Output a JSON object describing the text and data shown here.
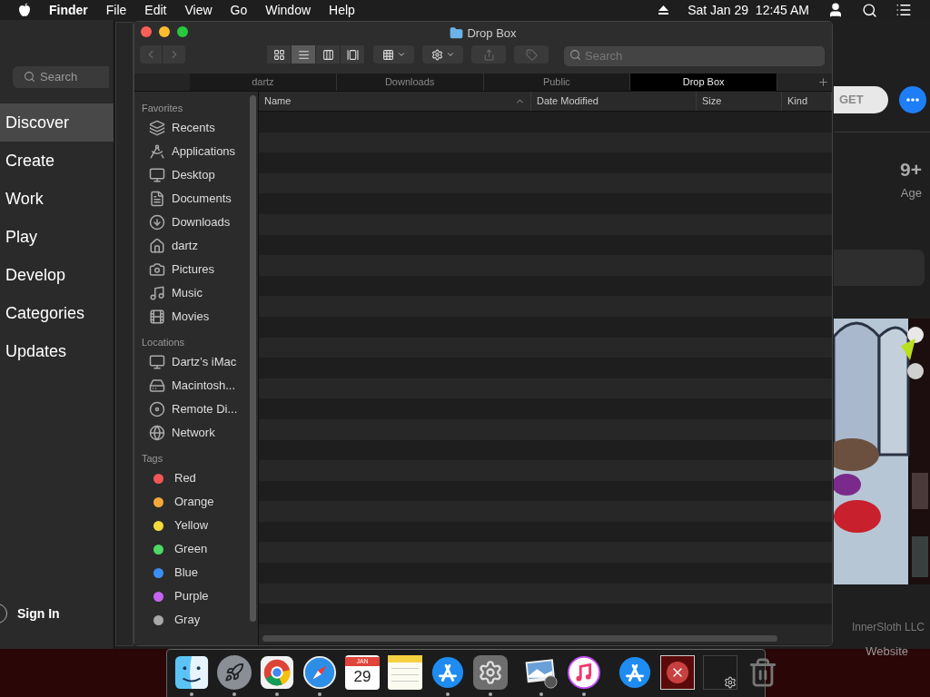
{
  "menu_bar": {
    "app": "Finder",
    "menus": [
      "File",
      "Edit",
      "View",
      "Go",
      "Window",
      "Help"
    ],
    "clock": "Sat Jan 29  12:45 AM"
  },
  "app_store": {
    "search": {
      "placeholder": "Search"
    },
    "nav": [
      {
        "label": "Discover",
        "selected": true
      },
      {
        "label": "Create",
        "selected": false
      },
      {
        "label": "Work",
        "selected": false
      },
      {
        "label": "Play",
        "selected": false
      },
      {
        "label": "Develop",
        "selected": false
      },
      {
        "label": "Categories",
        "selected": false
      },
      {
        "label": "Updates",
        "selected": false
      }
    ],
    "sign_in": "Sign In",
    "get_button": "GET",
    "age": {
      "value": "9+",
      "label": "Age"
    },
    "developer": "InnerSloth LLC",
    "link": "Website"
  },
  "finder": {
    "title": "Drop Box",
    "view_modes": [
      {
        "kind": "icon",
        "selected": false
      },
      {
        "kind": "list",
        "selected": true
      },
      {
        "kind": "column",
        "selected": false
      },
      {
        "kind": "gallery",
        "selected": false
      }
    ],
    "share_disabled": true,
    "tags_disabled": true,
    "search": {
      "placeholder": "Search"
    },
    "tabs": [
      {
        "label": "dartz",
        "selected": false
      },
      {
        "label": "Downloads",
        "selected": false
      },
      {
        "label": "Public",
        "selected": false
      },
      {
        "label": "Drop Box",
        "selected": true
      }
    ],
    "sidebar": [
      {
        "heading": "Favorites",
        "items": [
          {
            "label": "Recents",
            "kind": "recents"
          },
          {
            "label": "Applications",
            "kind": "applications"
          },
          {
            "label": "Desktop",
            "kind": "desktop"
          },
          {
            "label": "Documents",
            "kind": "documents"
          },
          {
            "label": "Downloads",
            "kind": "downloads"
          },
          {
            "label": "dartz",
            "kind": "home"
          },
          {
            "label": "Pictures",
            "kind": "pictures"
          },
          {
            "label": "Music",
            "kind": "music"
          },
          {
            "label": "Movies",
            "kind": "movies"
          }
        ]
      },
      {
        "heading": "Locations",
        "items": [
          {
            "label": "Dartz’s iMac",
            "kind": "computer"
          },
          {
            "label": "Macintosh...",
            "kind": "disk"
          },
          {
            "label": "Remote Di...",
            "kind": "disc"
          },
          {
            "label": "Network",
            "kind": "network"
          }
        ]
      },
      {
        "heading": "Tags",
        "items": [
          {
            "label": "Red",
            "kind": "tag",
            "color": "#f25757"
          },
          {
            "label": "Orange",
            "kind": "tag",
            "color": "#f5a83a"
          },
          {
            "label": "Yellow",
            "kind": "tag",
            "color": "#f5dc3a"
          },
          {
            "label": "Green",
            "kind": "tag",
            "color": "#4cd964"
          },
          {
            "label": "Blue",
            "kind": "tag",
            "color": "#3a8ef5"
          },
          {
            "label": "Purple",
            "kind": "tag",
            "color": "#c464f0"
          },
          {
            "label": "Gray",
            "kind": "tag",
            "color": "#a8a8a8"
          }
        ]
      }
    ],
    "columns": [
      {
        "label": "Name",
        "sorted": true
      },
      {
        "label": "Date Modified",
        "sorted": false
      },
      {
        "label": "Size",
        "sorted": false
      },
      {
        "label": "Kind",
        "sorted": false
      }
    ]
  },
  "dock": {
    "items": [
      {
        "kind": "finder",
        "running": true
      },
      {
        "kind": "launchpad",
        "running": true
      },
      {
        "kind": "chrome",
        "running": true
      },
      {
        "kind": "safari",
        "running": true
      },
      {
        "kind": "calendar",
        "running": false,
        "month": "JAN",
        "day": "29"
      },
      {
        "kind": "notes",
        "running": false
      },
      {
        "kind": "appstore",
        "running": true
      },
      {
        "kind": "settings",
        "running": true
      },
      {
        "kind": "separator"
      },
      {
        "kind": "preview",
        "running": true
      },
      {
        "kind": "music",
        "running": true
      },
      {
        "kind": "separator"
      },
      {
        "kind": "appstore",
        "running": false
      },
      {
        "kind": "error",
        "running": false
      },
      {
        "kind": "screenshot",
        "running": false
      },
      {
        "kind": "trash",
        "running": false
      }
    ]
  }
}
